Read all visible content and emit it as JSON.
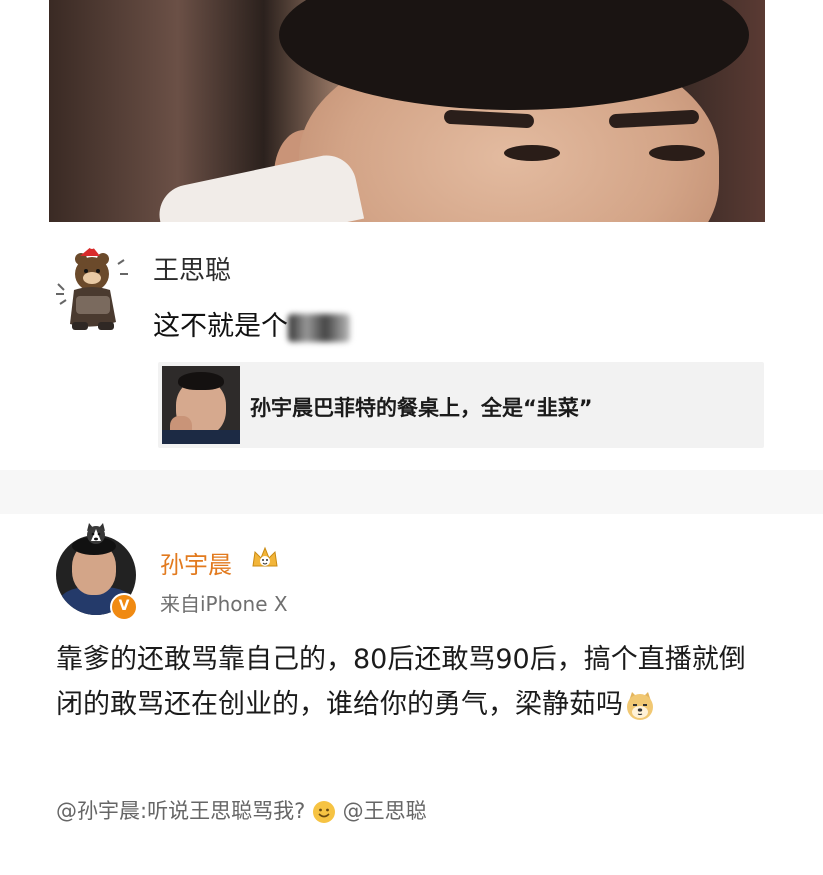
{
  "top_photo": {
    "alt": ""
  },
  "comment": {
    "author": "王思聪",
    "text": "这不就是个",
    "quote": {
      "text": "孙宇晨巴菲特的餐桌上，全是“韭菜”"
    }
  },
  "post": {
    "author": "孙宇晨",
    "source": "来自iPhone X",
    "verified_badge": "V",
    "body": "靠爹的还敢骂靠自己的，80后还敢骂90后，搞个直播就倒闭的敢骂还在创业的，谁给你的勇气，梁静茹吗",
    "footer_prefix": "@孙宇晨:听说王思聪骂我?",
    "footer_mention": "@王思聪"
  },
  "colors": {
    "author_orange": "#e27a1e",
    "badge_orange": "#f08a12",
    "quote_bg": "#f2f2f2"
  },
  "icons": [
    "sticker-icon",
    "husky-icon",
    "vip-crown-icon",
    "doge-emoji-icon",
    "smile-emoji-icon",
    "verified-badge-icon"
  ]
}
